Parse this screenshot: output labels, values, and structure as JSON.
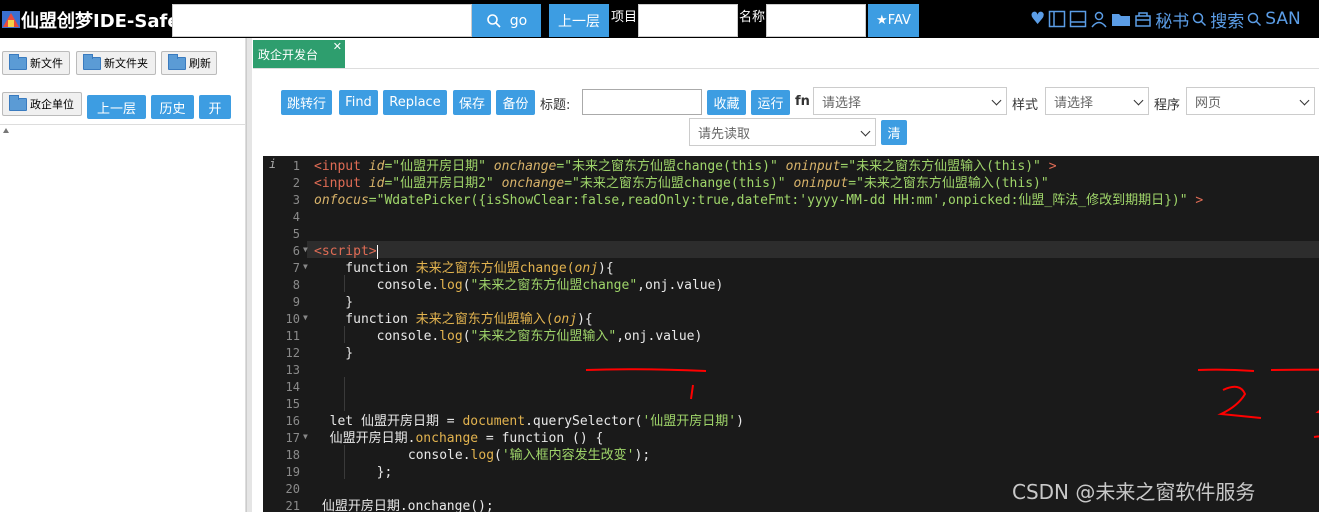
{
  "app": {
    "title": "仙盟创梦IDE-Safe"
  },
  "topbar": {
    "go_label": "go",
    "up_label": "上一层",
    "project_label": "项目:",
    "name_label": "名称:",
    "fav_label": "★FAV",
    "right_items": [
      "♥",
      "▢",
      "▭",
      "👤",
      "📁",
      "🏛",
      "秘书",
      "搜索",
      "SAN"
    ]
  },
  "sidebar": {
    "new_file": "新文件",
    "new_folder": "新文件夹",
    "refresh": "刷新",
    "unit": "政企单位",
    "up": "上一层",
    "history": "历史",
    "open": "开"
  },
  "tab": {
    "label": "政企开发台",
    "close": "✕"
  },
  "toolbar": {
    "goto": "跳转行",
    "find": "Find",
    "replace": "Replace",
    "save": "保存",
    "backup": "备份",
    "title_label": "标题:",
    "collect": "收藏",
    "run": "运行",
    "fn_label": "fn",
    "fn_placeholder": "请选择",
    "style_label": "样式",
    "style_placeholder": "请选择",
    "program_label": "程序",
    "program_value": "网页",
    "read_placeholder": "请先读取",
    "clear": "清"
  },
  "editor": {
    "line_numbers": [
      "1",
      "2",
      "3",
      "4",
      "5",
      "6",
      "7",
      "8",
      "9",
      "10",
      "11",
      "12",
      "13",
      "14",
      "15",
      "16",
      "17",
      "18",
      "19",
      "20",
      "21"
    ],
    "lines": {
      "l1_tag": "<input ",
      "l1_a1": "id",
      "l1_s1": "=\"仙盟开房日期\" ",
      "l1_a2": "onchange",
      "l1_s2": "=\"未来之窗东方仙盟change(this)\" ",
      "l1_a3": "oninput",
      "l1_s3": "=\"未来之窗东方仙盟输入(this)\" ",
      "l1_end": ">",
      "l2_tag": "<input ",
      "l2_a1": "id",
      "l2_s1": "=\"仙盟开房日期2\" ",
      "l2_a2": "onchange",
      "l2_s2": "=\"未来之窗东方仙盟change(this)\" ",
      "l2_a3": "oninput",
      "l2_s3": "=\"未来之窗东方仙盟输入(this)\"",
      "l3_a1": "onfocus",
      "l3_s1": "=\"WdatePicker({isShowClear:false,readOnly:true,dateFmt:'yyyy-MM-dd HH:mm',onpicked:仙盟_阵法_修改到期期日})\" ",
      "l3_end": ">",
      "l6_tag": "<script>",
      "l7_kw": "    function ",
      "l7_fn": "未来之窗东方仙盟change(",
      "l7_p": "onj",
      "l7_e": "){",
      "l8_a": "        console.",
      "l8_b": "log",
      "l8_c": "(",
      "l8_s": "\"未来之窗东方仙盟change\"",
      "l8_d": ",onj.value)",
      "l9": "    }",
      "l10_kw": "    function ",
      "l10_fn": "未来之窗东方仙盟输入(",
      "l10_p": "onj",
      "l10_e": "){",
      "l11_a": "        console.",
      "l11_b": "log",
      "l11_c": "(",
      "l11_s": "\"未来之窗东方仙盟输入\"",
      "l11_d": ",onj.value)",
      "l12": "    }",
      "l16_a": "  let 仙盟开房日期 = ",
      "l16_b": "document",
      "l16_c": ".querySelector(",
      "l16_s": "'仙盟开房日期'",
      "l16_d": ")",
      "l17_a": "  仙盟开房日期.",
      "l17_b": "onchange",
      "l17_c": " = function () {",
      "l18_a": "            console.",
      "l18_b": "log",
      "l18_c": "(",
      "l18_s": "'输入框内容发生改变'",
      "l18_d": ");",
      "l19": "        };",
      "l21": " 仙盟开房日期.onchange();"
    }
  },
  "watermark": "CSDN @未来之窗软件服务",
  "colors": {
    "accent": "#3d9de2",
    "tab": "#2e9e6e",
    "editor_bg": "#1a1a1a",
    "annotation": "#ff0000"
  }
}
